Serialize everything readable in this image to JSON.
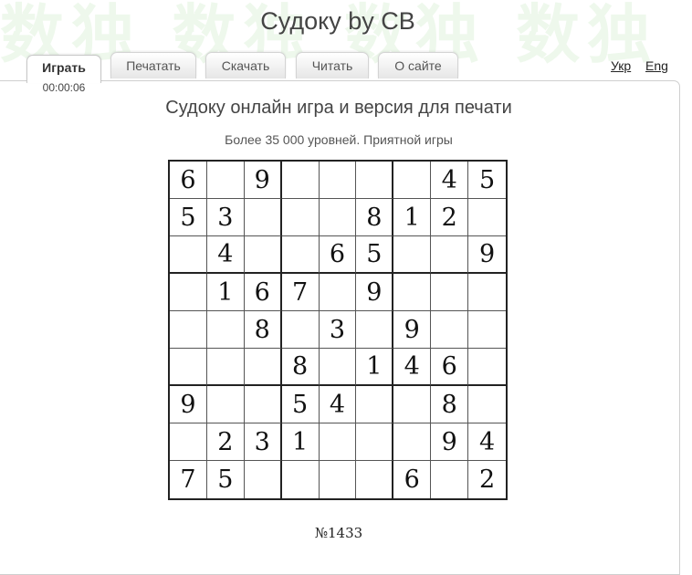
{
  "watermark": "数独 数独 数独 数独",
  "site_title": "Судоку by CB",
  "tabs": [
    {
      "label": "Играть",
      "active": true
    },
    {
      "label": "Печатать",
      "active": false
    },
    {
      "label": "Скачать",
      "active": false
    },
    {
      "label": "Читать",
      "active": false
    },
    {
      "label": "О сайте",
      "active": false
    }
  ],
  "timer": "00:00:06",
  "languages": [
    "Укр",
    "Eng"
  ],
  "page_heading": "Судоку онлайн игра и версия для печати",
  "sub_heading": "Более 35 000 уровней. Приятной игры",
  "grid": [
    [
      "6",
      "",
      "9",
      "",
      "",
      "",
      "",
      "4",
      "5"
    ],
    [
      "5",
      "3",
      "",
      "",
      "",
      "8",
      "1",
      "2",
      ""
    ],
    [
      "",
      "4",
      "",
      "",
      "6",
      "5",
      "",
      "",
      "9"
    ],
    [
      "",
      "1",
      "6",
      "7",
      "",
      "9",
      "",
      "",
      ""
    ],
    [
      "",
      "",
      "8",
      "",
      "3",
      "",
      "9",
      "",
      ""
    ],
    [
      "",
      "",
      "",
      "8",
      "",
      "1",
      "4",
      "6",
      ""
    ],
    [
      "9",
      "",
      "",
      "5",
      "4",
      "",
      "",
      "8",
      ""
    ],
    [
      "",
      "2",
      "3",
      "1",
      "",
      "",
      "",
      "9",
      "4"
    ],
    [
      "7",
      "5",
      "",
      "",
      "",
      "",
      "6",
      "",
      "2"
    ]
  ],
  "puzzle_number": "№1433"
}
